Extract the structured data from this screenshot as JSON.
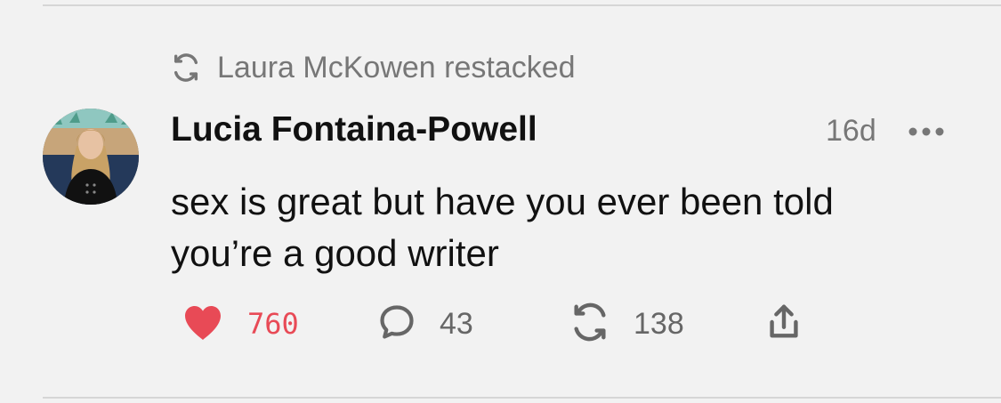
{
  "restack": {
    "text": "Laura McKowen restacked",
    "icon": "restack-icon"
  },
  "post": {
    "author": "Lucia Fontaina-Powell",
    "time": "16d",
    "body_lines": [
      "sex is great but have you ever been told",
      "you’re a good writer"
    ]
  },
  "actions": {
    "likes": "760",
    "comments": "43",
    "restacks": "138"
  },
  "colors": {
    "background": "#f2f2f2",
    "like": "#e84a56",
    "muted": "#777777",
    "text": "#111111"
  },
  "icons": [
    "restack-icon",
    "more-icon",
    "heart-icon",
    "comment-icon",
    "share-icon"
  ]
}
